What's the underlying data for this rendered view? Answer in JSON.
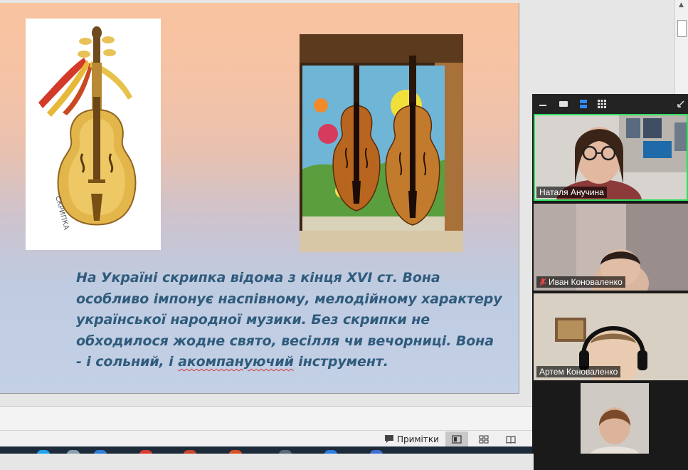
{
  "slide": {
    "text_parts": [
      "На  Україні скрипка відома з кінця XVI ст. Вона особливо імпонує наспівному, мелодійному характеру української народної музики. Без скрипки не обходилося жодне свято, весілля чи вечорниці. Вона - і сольний, і ",
      "акомпануючий",
      " інструмент."
    ],
    "image1_caption": "СКРИПКА"
  },
  "status_bar": {
    "notes_label": "Примітки"
  },
  "colors": {
    "slide_text": "#2f5b7c",
    "active_speaker_border": "#2fe05e",
    "taskbar": "#1c2a3a"
  },
  "participants": [
    {
      "name": "Наталя Анучина",
      "muted": false,
      "active": true
    },
    {
      "name": "Иван Коноваленко",
      "muted": true,
      "active": false
    },
    {
      "name": "Артем Коноваленко",
      "muted": false,
      "active": false
    },
    {
      "name": "",
      "muted": false,
      "active": false
    }
  ]
}
